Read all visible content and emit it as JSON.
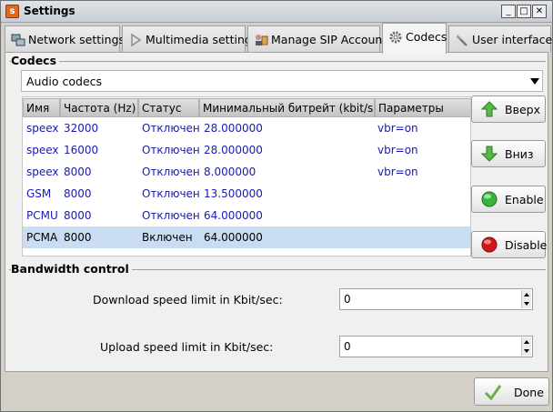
{
  "window": {
    "title": "Settings"
  },
  "tabs": [
    {
      "label": "Network settings",
      "icon": "network-settings-icon"
    },
    {
      "label": "Multimedia settings",
      "icon": "play-icon"
    },
    {
      "label": "Manage SIP Accounts",
      "icon": "accounts-icon"
    },
    {
      "label": "Codecs",
      "icon": "gear-icon",
      "active": true
    },
    {
      "label": "User interface",
      "icon": "user-interface-icon"
    }
  ],
  "codecs": {
    "group_title": "Codecs",
    "codec_type_selected": "Audio codecs",
    "columns": [
      "Имя",
      "Частота (Hz)",
      "Статус",
      "Минимальный битрейт (kbit/s)",
      "Параметры"
    ],
    "rows": [
      {
        "name": "speex",
        "freq": "32000",
        "status": "Отключен",
        "bitrate": "28.000000",
        "params": "vbr=on"
      },
      {
        "name": "speex",
        "freq": "16000",
        "status": "Отключен",
        "bitrate": "28.000000",
        "params": "vbr=on"
      },
      {
        "name": "speex",
        "freq": "8000",
        "status": "Отключен",
        "bitrate": "8.000000",
        "params": "vbr=on"
      },
      {
        "name": "GSM",
        "freq": "8000",
        "status": "Отключен",
        "bitrate": "13.500000",
        "params": ""
      },
      {
        "name": "PCMU",
        "freq": "8000",
        "status": "Отключен",
        "bitrate": "64.000000",
        "params": ""
      },
      {
        "name": "PCMA",
        "freq": "8000",
        "status": "Включен",
        "bitrate": "64.000000",
        "params": "",
        "selected": true
      }
    ],
    "buttons": {
      "up": "Вверх",
      "down": "Вниз",
      "enable": "Enable",
      "disable": "Disable"
    }
  },
  "bandwidth": {
    "group_title": "Bandwidth control",
    "download_label": "Download speed limit in Kbit/sec:",
    "download_value": "0",
    "upload_label": "Upload speed limit in Kbit/sec:",
    "upload_value": "0"
  },
  "footer": {
    "done_label": "Done"
  },
  "colors": {
    "codec_text": "#1a1ab4",
    "selected_row": "#c9dcf2",
    "enable_green": "#3cb43c",
    "disable_red": "#d01818"
  }
}
